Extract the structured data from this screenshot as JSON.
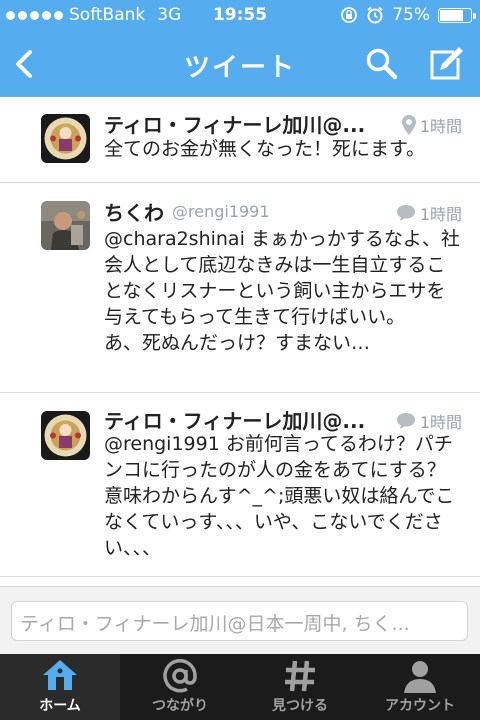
{
  "status_bar": {
    "carrier": "SoftBank",
    "network": "3G",
    "time": "19:55",
    "battery": "75%",
    "battery_level": 0.75
  },
  "nav": {
    "title": "ツイート",
    "back_icon": "chevron-left-icon",
    "search_icon": "search-icon",
    "compose_icon": "compose-icon"
  },
  "tweets": [
    {
      "name": "ティロ・フィナーレ加川@...",
      "handle": "",
      "time": "1時間",
      "meta_icon": "location-pin-icon",
      "text": "全てのお金が無くなった！死にます。"
    },
    {
      "name": "ちくわ",
      "handle": "@rengi1991",
      "time": "1時間",
      "meta_icon": "speech-bubble-icon",
      "text": "@chara2shinai まぁかっかするなよ、社会人として底辺なきみは一生自立することなくリスナーという飼い主からエサを与えてもらって生きて行けばいい。\nあ、死ぬんだっけ？すまない…"
    },
    {
      "name": "ティロ・フィナーレ加川@...",
      "handle": "",
      "time": "1時間",
      "meta_icon": "speech-bubble-icon",
      "text": "@rengi1991 お前何言ってるわけ？パチンコに行ったのが人の金をあてにする？意味わからんす^_^;頭悪い奴は絡んでこなくていっす、、、いや、こないでください、、、"
    }
  ],
  "reply": {
    "placeholder": "ティロ・フィナーレ加川@日本一周中, ちく..."
  },
  "tabs": [
    {
      "label": "ホーム",
      "icon": "home-icon",
      "active": true
    },
    {
      "label": "つながり",
      "icon": "at-sign-icon",
      "active": false
    },
    {
      "label": "見つける",
      "icon": "hashtag-icon",
      "active": false
    },
    {
      "label": "アカウント",
      "icon": "person-icon",
      "active": false
    }
  ],
  "colors": {
    "header": "#55acee",
    "tabbar": "#1b1b1b",
    "active_tab_icon": "#55acee"
  }
}
